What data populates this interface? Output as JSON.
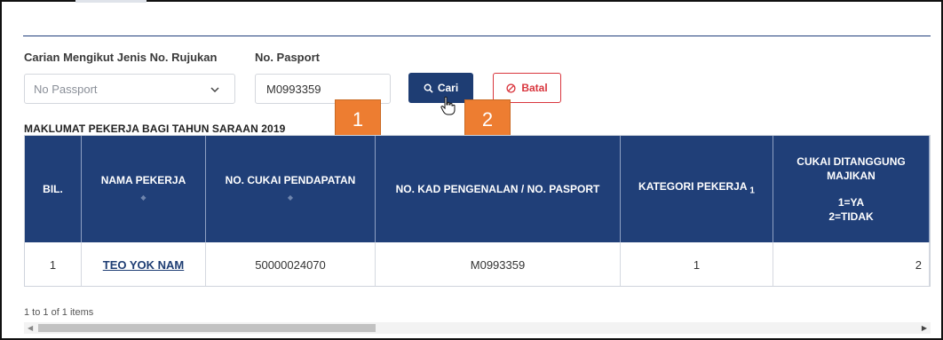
{
  "search": {
    "type_label": "Carian Mengikut Jenis No. Rujukan",
    "type_value": "No Passport",
    "passport_label": "No. Pasport",
    "passport_value": "M0993359",
    "search_button": "Cari",
    "cancel_button": "Batal"
  },
  "callouts": [
    "1",
    "2"
  ],
  "section_title": "MAKLUMAT PEKERJA BAGI TAHUN SARAAN 2019",
  "table": {
    "headers": {
      "bil": "BIL.",
      "nama": "NAMA PEKERJA",
      "cukai": "NO. CUKAI PENDAPATAN",
      "kad": "NO. KAD PENGENALAN / NO. PASPORT",
      "kategori": "KATEGORI PEKERJA",
      "kategori_sub": "1",
      "ditanggung_1": "CUKAI DITANGGUNG",
      "ditanggung_2": "MAJIKAN",
      "ditanggung_3": "1=YA",
      "ditanggung_4": "2=TIDAK"
    },
    "rows": [
      {
        "bil": "1",
        "nama": "TEO YOK NAM",
        "cukai": "50000024070",
        "kad": "M0993359",
        "kategori": "1",
        "ditanggung": "2"
      }
    ]
  },
  "pager_text": "1 to 1 of 1 items",
  "colors": {
    "primary": "#1e3d73",
    "header": "#203f78",
    "danger": "#d9363e",
    "callout": "#ed7d31"
  }
}
